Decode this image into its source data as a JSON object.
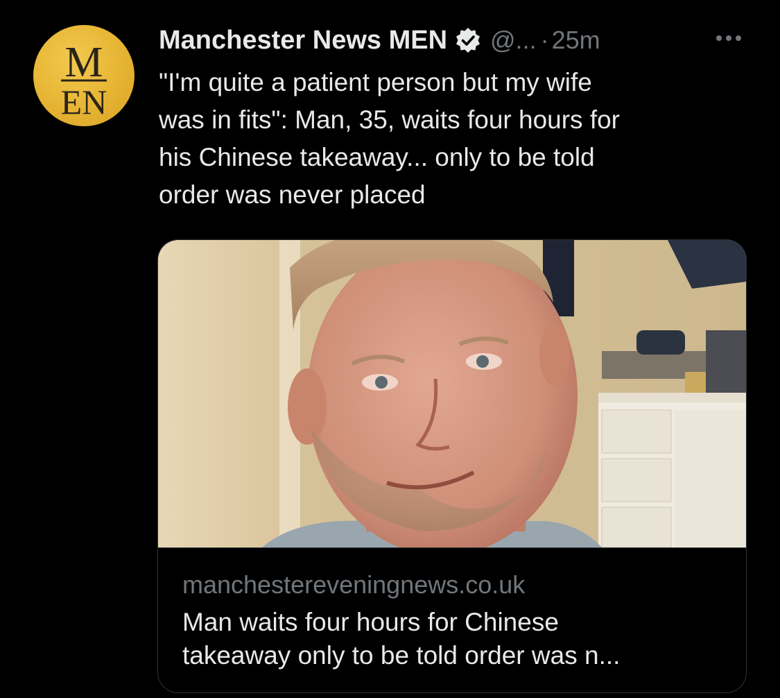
{
  "account": {
    "display_name": "Manchester News MEN",
    "handle": "@...",
    "separator": "·",
    "timestamp": "25m",
    "avatar_logo_top": "M",
    "avatar_logo_bottom": "EN",
    "verified": true
  },
  "icons": {
    "verified": "verified-badge-icon",
    "more": "more-horizontal-icon"
  },
  "tweet": {
    "text": "\"I'm quite a patient person but my wife\nwas in fits\": Man, 35, waits four hours for\nhis Chinese takeaway... only to be told\norder was never placed"
  },
  "card": {
    "domain": "manchestereveningnews.co.uk",
    "title": "Man waits four hours for Chinese\ntakeaway only to be told order was n..."
  },
  "colors": {
    "background": "#000000",
    "primary_text": "#e7e9ea",
    "secondary_text": "#71767b",
    "border": "#2f3336",
    "avatar_gold": "#e6b433"
  }
}
